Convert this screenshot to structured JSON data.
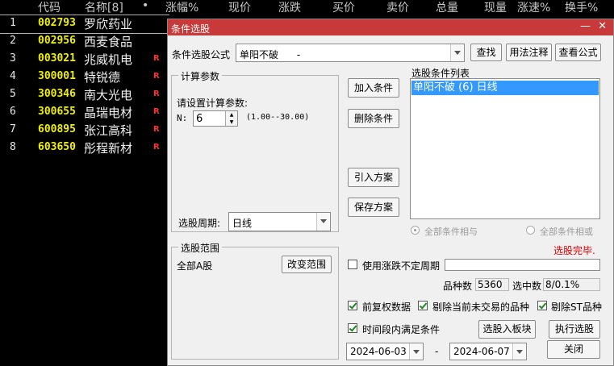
{
  "table": {
    "headers": [
      "代码",
      "名称[8]",
      "•",
      "涨幅%",
      "现价",
      "涨跌",
      "买价",
      "卖价",
      "总量",
      "现量",
      "涨速%",
      "换手%"
    ],
    "rows": [
      {
        "idx": "1",
        "code": "002793",
        "name": "罗欣药业",
        "flag": ""
      },
      {
        "idx": "2",
        "code": "002956",
        "name": "西麦食品",
        "flag": ""
      },
      {
        "idx": "3",
        "code": "003021",
        "name": "兆威机电",
        "flag": "R"
      },
      {
        "idx": "4",
        "code": "300001",
        "name": "特锐德",
        "flag": "R"
      },
      {
        "idx": "5",
        "code": "300346",
        "name": "南大光电",
        "flag": "R"
      },
      {
        "idx": "6",
        "code": "300655",
        "name": "晶瑞电材",
        "flag": "R"
      },
      {
        "idx": "7",
        "code": "600895",
        "name": "张江高科",
        "flag": "R"
      },
      {
        "idx": "8",
        "code": "603650",
        "name": "彤程新材",
        "flag": "R"
      }
    ]
  },
  "dialog": {
    "title": "条件选股",
    "formula_label": "条件选股公式",
    "formula_value": "单阳不破      -",
    "find_btn": "查找",
    "usage_btn": "用法注释",
    "view_btn": "查看公式",
    "calc_group": "计算参数",
    "calc_prompt": "请设置计算参数:",
    "param_name": "N:",
    "param_value": "6",
    "param_range": "(1.00--30.00)",
    "period_label": "选股周期:",
    "period_value": "日线",
    "add_btn": "加入条件",
    "del_btn": "删除条件",
    "import_btn": "引入方案",
    "save_btn": "保存方案",
    "list_label": "选股条件列表",
    "list_items": [
      "单阳不破 (6) 日线"
    ],
    "radio_and": "全部条件相与",
    "radio_or": "全部条件相或",
    "status": "选股完毕.",
    "range_group": "选股范围",
    "range_value": "全部A股",
    "change_range_btn": "改变范围",
    "use_uncertain_label": "使用涨跌不定周期",
    "count_label": "品种数",
    "count_value": "5360",
    "selected_label": "选中数",
    "selected_value": "8/0.1%",
    "fq_label": "前复权数据",
    "exclude_label": "剔除当前未交易的品种",
    "st_label": "剔除ST品种",
    "time_label": "时间段内满足条件",
    "to_block_btn": "选股入板块",
    "run_btn": "执行选股",
    "date_from": "2024-06-03",
    "date_sep": "-",
    "date_to": "2024-06-07",
    "close_btn": "关闭",
    "minimize": "—",
    "close_x": "✕"
  },
  "colors": {
    "title_bar": "#c83a3a",
    "code": "#f0f000",
    "flag": "#ff3030",
    "status": "#e00000",
    "list_sel": "#3399ff"
  }
}
